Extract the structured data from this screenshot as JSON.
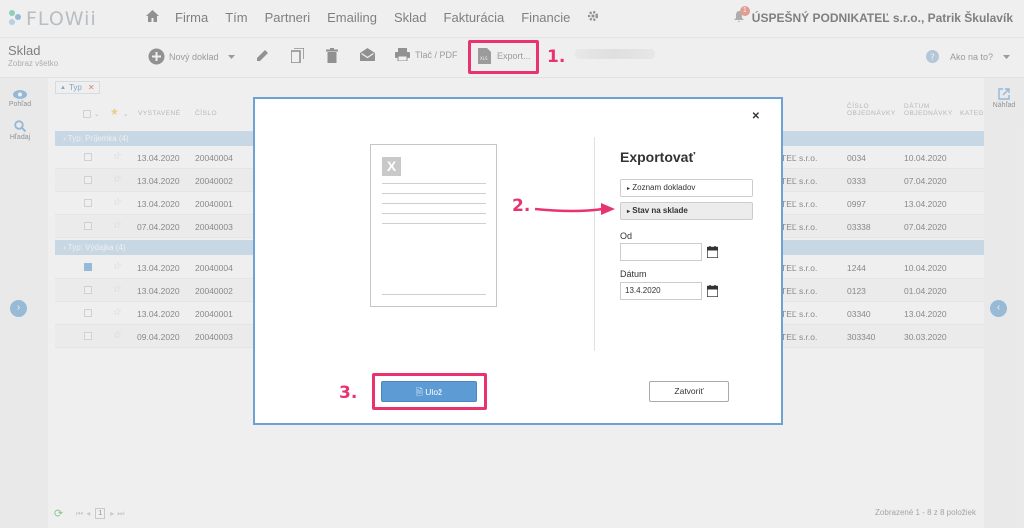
{
  "app": {
    "logo_text": "FLOWii"
  },
  "nav": {
    "items": [
      "Firma",
      "Tím",
      "Partneri",
      "Emailing",
      "Sklad",
      "Fakturácia",
      "Financie"
    ]
  },
  "user": {
    "notif_count": "1",
    "label": "ÚSPEŠNÝ PODNIKATEĽ s.r.o., Patrik Škulavík"
  },
  "module": {
    "title": "Sklad",
    "subtitle": "Zobraz všetko"
  },
  "toolbar": {
    "new_doc": "Nový doklad",
    "print": "Tlač / PDF",
    "export": "Export..."
  },
  "help": {
    "label": "Ako na to?"
  },
  "left_rail": {
    "view": "Pohľad",
    "search": "Hľadaj"
  },
  "right_rail": {
    "preview": "Náhľad"
  },
  "filter": {
    "chip_label": "Typ"
  },
  "table": {
    "headers": {
      "issued": "VYSTAVENÉ",
      "number": "ČÍSLO",
      "order_number": [
        "ČÍSLO",
        "OBJEDNÁVKY"
      ],
      "order_date": [
        "DÁTUM",
        "OBJEDNÁVKY"
      ],
      "category": "KATEG"
    },
    "groups": [
      {
        "label": "Typ: Príjemka (4)",
        "rows": [
          {
            "date": "13.04.2020",
            "num": "20040004",
            "partner": "TEĽ s.r.o.",
            "order_num": "0034",
            "order_date": "10.04.2020",
            "checked": false
          },
          {
            "date": "13.04.2020",
            "num": "20040002",
            "partner": "TEĽ s.r.o.",
            "order_num": "0333",
            "order_date": "07.04.2020",
            "checked": false
          },
          {
            "date": "13.04.2020",
            "num": "20040001",
            "partner": "TEĽ s.r.o.",
            "order_num": "0997",
            "order_date": "13.04.2020",
            "checked": false
          },
          {
            "date": "07.04.2020",
            "num": "20040003",
            "partner": "TEĽ s.r.o.",
            "order_num": "03338",
            "order_date": "07.04.2020",
            "checked": false
          }
        ]
      },
      {
        "label": "Typ: Výdajka (4)",
        "rows": [
          {
            "date": "13.04.2020",
            "num": "20040004",
            "partner": "TEĽ s.r.o.",
            "order_num": "1244",
            "order_date": "10.04.2020",
            "checked": true
          },
          {
            "date": "13.04.2020",
            "num": "20040002",
            "partner": "TEĽ s.r.o.",
            "order_num": "0123",
            "order_date": "01.04.2020",
            "checked": false
          },
          {
            "date": "13.04.2020",
            "num": "20040001",
            "partner": "TEĽ s.r.o.",
            "order_num": "03340",
            "order_date": "13.04.2020",
            "checked": false
          },
          {
            "date": "09.04.2020",
            "num": "20040003",
            "partner": "TEĽ s.r.o.",
            "order_num": "303340",
            "order_date": "30.03.2020",
            "checked": false
          }
        ]
      }
    ]
  },
  "pagination": {
    "page": "1",
    "summary": "Zobrazené 1 - 8 z 8 položiek"
  },
  "modal": {
    "title": "Exportovať",
    "options": [
      "Zoznam dokladov",
      "Stav na sklade"
    ],
    "from_label": "Od",
    "from_value": "",
    "date_label": "Dátum",
    "date_value": "13.4.2020",
    "save_label": "Ulož",
    "close_label": "Zatvoriť"
  },
  "annotations": {
    "step1": "1.",
    "step2": "2.",
    "step3": "3.",
    "color": "#e8336e"
  }
}
